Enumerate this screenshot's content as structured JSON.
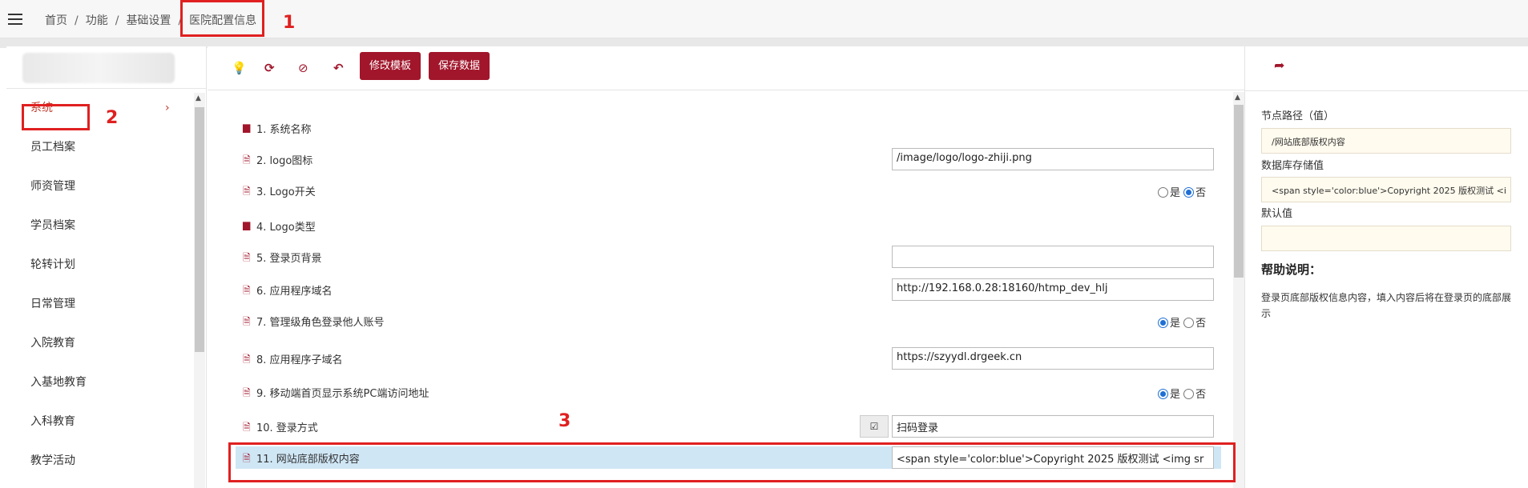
{
  "breadcrumb": {
    "items": [
      "首页",
      "功能",
      "基础设置",
      "医院配置信息"
    ],
    "separator": "/"
  },
  "annotations": [
    "1",
    "2",
    "3"
  ],
  "sidebar": {
    "items": [
      {
        "label": "系统",
        "active": true,
        "arrow": "›"
      },
      {
        "label": "员工档案"
      },
      {
        "label": "师资管理"
      },
      {
        "label": "学员档案"
      },
      {
        "label": "轮转计划"
      },
      {
        "label": "日常管理"
      },
      {
        "label": "入院教育"
      },
      {
        "label": "入基地教育"
      },
      {
        "label": "入科教育"
      },
      {
        "label": "教学活动"
      }
    ]
  },
  "toolbar": {
    "icons": [
      "lightbulb-icon",
      "refresh-icon",
      "hide-icon",
      "undo-icon"
    ],
    "edit_template_label": "修改模板",
    "save_data_label": "保存数据"
  },
  "config_rows": [
    {
      "label": "1. 系统名称",
      "type": "folder"
    },
    {
      "label": "2. logo图标",
      "type": "text",
      "value": "/image/logo/logo-zhiji.png"
    },
    {
      "label": "3. Logo开关",
      "type": "radio",
      "yes": "是",
      "no": "否",
      "selected": "no"
    },
    {
      "label": "4. Logo类型",
      "type": "folder"
    },
    {
      "label": "5. 登录页背景",
      "type": "text",
      "value": ""
    },
    {
      "label": "6. 应用程序域名",
      "type": "text",
      "value": "http://192.168.0.28:18160/htmp_dev_hlj"
    },
    {
      "label": "7. 管理级角色登录他人账号",
      "type": "radio",
      "yes": "是",
      "no": "否",
      "selected": "yes"
    },
    {
      "label": "8. 应用程序子域名",
      "type": "text",
      "value": "https://szyydl.drgeek.cn"
    },
    {
      "label": "9. 移动端首页显示系统PC端访问地址",
      "type": "radio",
      "yes": "是",
      "no": "否",
      "selected": "yes"
    },
    {
      "label": "10. 登录方式",
      "type": "checktext",
      "value": "扫码登录"
    },
    {
      "label": "11. 网站底部版权内容",
      "type": "text",
      "value": "<span style='color:blue'>Copyright 2025 版权测试 <img sr",
      "selected": true
    }
  ],
  "detail": {
    "node_path_label": "节点路径（值）",
    "node_path_value": "/网站底部版权内容",
    "db_value_label": "数据库存储值",
    "db_value": "<span style='color:blue'>Copyright 2025 版权测试 <i",
    "default_label": "默认值",
    "default_value": "",
    "help_title": "帮助说明：",
    "help_text": "登录页底部版权信息内容，填入内容后将在登录页的底部展示"
  },
  "colors": {
    "accent": "#a1162b",
    "highlight_red": "#e02020",
    "selected_row": "#cfe6f5",
    "detail_input_bg": "#fffbee"
  }
}
